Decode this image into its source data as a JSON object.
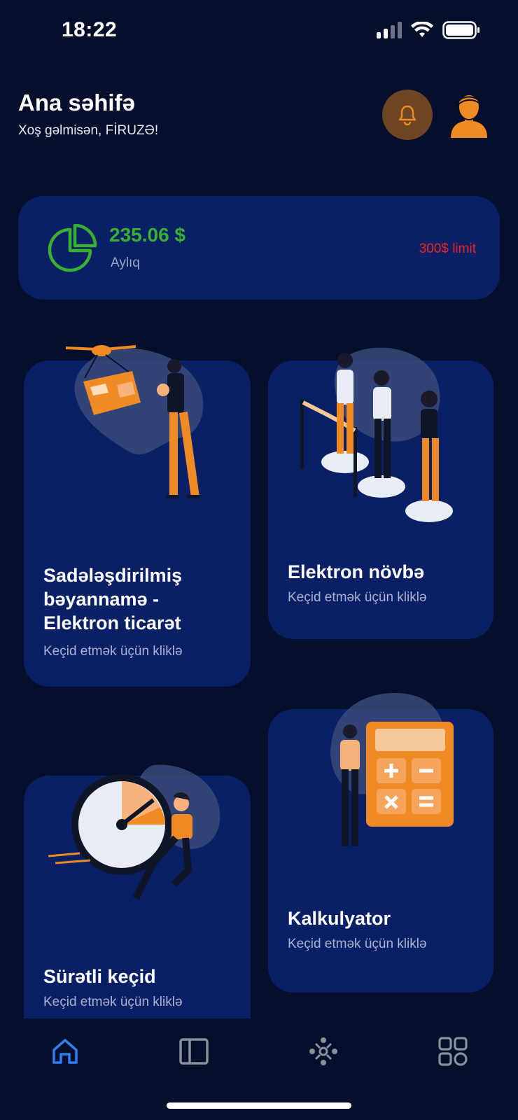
{
  "status": {
    "time": "18:22"
  },
  "header": {
    "title": "Ana səhifə",
    "welcome": "Xoş gəlmisən, FİRUZƏ!"
  },
  "summary": {
    "amount": "235.06 $",
    "period": "Aylıq",
    "limit": "300$ limit",
    "amount_color": "#37b12f",
    "limit_color": "#e8271f"
  },
  "tiles": [
    {
      "title_lines": [
        "Sadələşdirilmiş",
        "bəyannamə -",
        "Elektron ticarət"
      ],
      "subtitle": "Keçid etmək üçün kliklə"
    },
    {
      "title_lines": [
        "Elektron növbə"
      ],
      "subtitle": "Keçid etmək üçün kliklə"
    },
    {
      "title_lines": [
        "Sürətli keçid"
      ],
      "subtitle": "Keçid etmək üçün kliklə"
    },
    {
      "title_lines": [
        "Kalkulyator"
      ],
      "subtitle": "Keçid etmək üçün kliklə"
    }
  ],
  "nav": [
    {
      "icon": "home-icon",
      "active": true
    },
    {
      "icon": "sidebar-layout-icon",
      "active": false
    },
    {
      "icon": "network-people-icon",
      "active": false
    },
    {
      "icon": "grid-apps-icon",
      "active": false
    }
  ],
  "colors": {
    "background": "#040f2b",
    "card": "#0a2066",
    "accent": "#f08a24",
    "nav_active": "#2f7ef5"
  }
}
